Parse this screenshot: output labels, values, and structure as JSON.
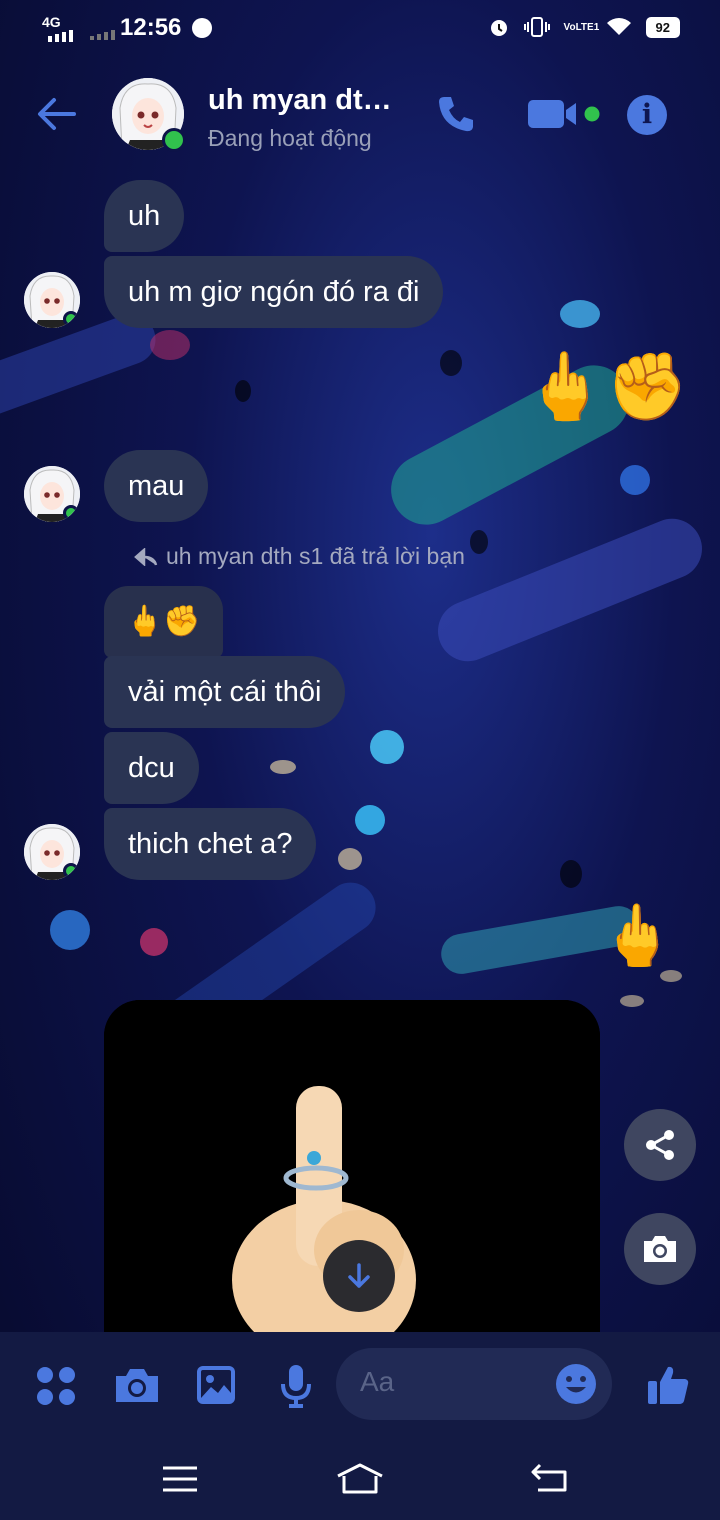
{
  "status_bar": {
    "network": "4G",
    "time": "12:56",
    "lte": "VoLTE1",
    "battery": "92"
  },
  "header": {
    "title": "uh myan dt…",
    "subtitle": "Đang hoạt động",
    "icons": [
      "back-arrow-icon",
      "phone-icon",
      "video-camera-icon",
      "info-icon"
    ]
  },
  "messages": [
    {
      "text": "uh"
    },
    {
      "text": "uh m giơ ngón đó ra đi"
    },
    {
      "text": "mau"
    },
    {
      "text": "vải một cái thôi"
    },
    {
      "text": "dcu"
    },
    {
      "text": "thich chet a?"
    }
  ],
  "reactions": {
    "sent_1": "🖕✊",
    "reply_quote": "🖕✊",
    "sent_2": "🖕"
  },
  "reply_note": "uh myan dth s1 đã trả lời bạn",
  "composer": {
    "placeholder": "Aa",
    "icons": [
      "apps-icon",
      "camera-icon",
      "gallery-icon",
      "microphone-icon",
      "emoji-icon",
      "like-icon"
    ]
  },
  "colors": {
    "accent": "#4b78df",
    "bubble": "#2a3453",
    "online": "#31c24d"
  }
}
